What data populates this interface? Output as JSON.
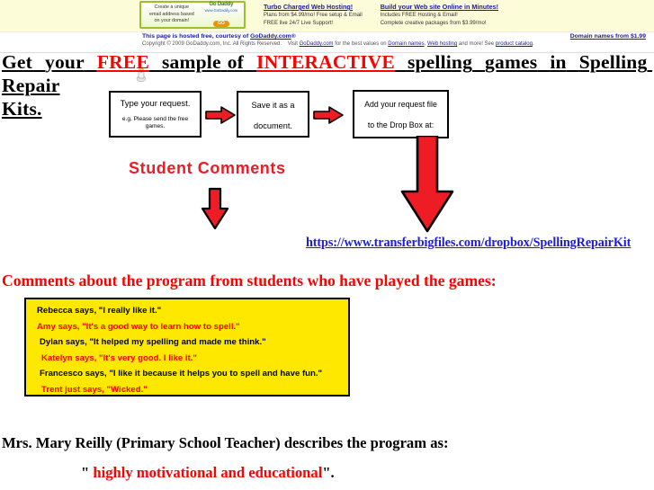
{
  "ad": {
    "promo_box": {
      "line1": "Create a unique",
      "line2": "email address based",
      "line3": "on your domain!",
      "logo_word": "Go Daddy",
      "logo_url": "www.GoDaddy.com",
      "go_label": "GO"
    },
    "columns": [
      {
        "heading": "Turbo Charged Web Hosting!",
        "lines": [
          "Plans from $4.99/mo! Free setup & Email",
          "FREE live 24/7 Live Support!"
        ]
      },
      {
        "heading": "Build your Web site Online in Minutes!",
        "lines": [
          "Includes FREE Hosting & Email!",
          "Complete creative packages from $3.99/mo!"
        ]
      }
    ]
  },
  "hosted_strip": {
    "line1_plain": "This page is hosted free, courtesy of ",
    "line1_link": "GoDaddy.com",
    "line1_suffix": "®",
    "right_link": "Domain names from $1.99",
    "line2_a": "Copyright © 2009 GoDaddy.com, Inc. All Rights Reserved.",
    "line2_visit": "Visit ",
    "line2_godaddy": "GoDaddy.com",
    "line2_b": " for the best values on ",
    "line2_domain": "Domain names",
    "line2_c": ", ",
    "line2_hosting": "Web hosting",
    "line2_d": " and more! See ",
    "line2_catalog": "product catalog",
    "line2_e": "."
  },
  "headline": {
    "w1": "Get",
    "w2": "your",
    "w3": "FREE",
    "w4": "sample",
    "w5": "of",
    "w6": "INTERACTIVE",
    "w7": "spelling",
    "w8": "games",
    "w9": "in",
    "w10": "Spelling",
    "w11": "Repair",
    "w12": "Kits."
  },
  "flow": {
    "box1": {
      "line1": "Type your request.",
      "line2": "e.g. Please send the free games."
    },
    "box2": {
      "line1": "Save it as a",
      "line2": "document."
    },
    "box3": {
      "line1": "Add your request file",
      "line2": "to the Drop Box at:"
    }
  },
  "student_comments_heading": "Student  Comments",
  "drop_link": "https://www.transferbigfiles.com/dropbox/SpellingRepairKit",
  "comments_heading": "Comments  about  the  program  from  students  who  have  played  the  games:",
  "comments": [
    {
      "text": "Rebecca says, \"I really like it.\"",
      "color": "black",
      "indent": "i0"
    },
    {
      "text": "Amy says, \"It's a good way to learn how to spell.\"",
      "color": "red",
      "indent": "i0"
    },
    {
      "text": "Dylan says, \"It helped my spelling and made me think.\"",
      "color": "black",
      "indent": "i1"
    },
    {
      "text": "Katelyn says, \"It's very good. I like it.\"",
      "color": "red",
      "indent": "i2"
    },
    {
      "text": "Francesco says, \"I like it because it helps you to spell and have fun.\"",
      "color": "black",
      "indent": "i1"
    },
    {
      "text": "Trent just says, \"Wicked.\"",
      "color": "red",
      "indent": "i2"
    }
  ],
  "teacher": {
    "line": "Mrs. Mary Reilly  (Primary School  Teacher)  describes  the  program  as:",
    "quote_open": "\"",
    "quote_text": " highly  motivational  and  educational",
    "quote_close": "\"."
  },
  "colors": {
    "red": "#ff0000",
    "arrow_red": "#ee1c25",
    "yellow": "#ffe800",
    "link_blue": "#1a1aee",
    "banner_bg": "#fdfcd8"
  }
}
